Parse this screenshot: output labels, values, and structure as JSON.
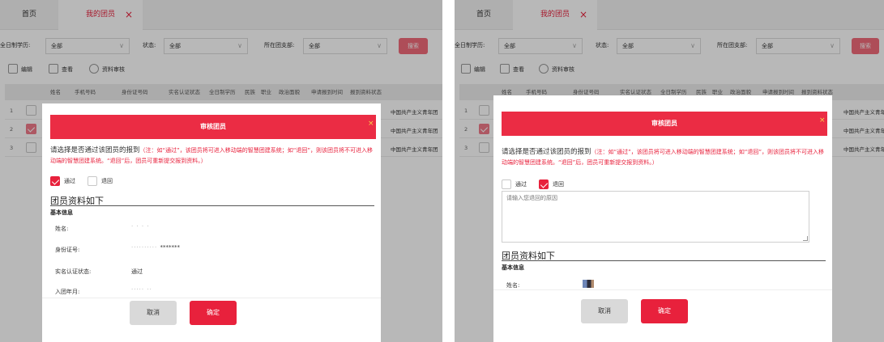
{
  "colors": {
    "accent": "#e8213c",
    "search": "#f16b7a",
    "dialog_header": "#eb2c44",
    "close_x": "#f7d34a"
  },
  "tabs": {
    "home": "首页",
    "current": "我的团员",
    "close": "×"
  },
  "filters": {
    "education_label": "全日制学历:",
    "education_value": "全部",
    "status_label": "状态:",
    "status_value": "全部",
    "branch_label": "所在团支部:",
    "branch_value": "全部",
    "search_label": "搜索"
  },
  "toolbar": {
    "edit": "编辑",
    "view": "查看",
    "review": "资料审核"
  },
  "table": {
    "headers": [
      "姓名",
      "手机号码",
      "身份证号码",
      "实名认证状态",
      "全日制学历",
      "民族",
      "职业",
      "政治面貌",
      "申请报到时间",
      "报到资料状态"
    ],
    "rows": [
      {
        "num": "1",
        "checked": false,
        "org": "中国共产主义青年团"
      },
      {
        "num": "2",
        "checked": true,
        "org": "中国共产主义青年团"
      },
      {
        "num": "3",
        "checked": false,
        "org": "中国共产主义青年团"
      }
    ]
  },
  "dialog": {
    "title": "审核团员",
    "close": "×",
    "question": "请选择是否通过该团员的报到",
    "note": "（注：如“通过”，该团员将可进入移动端的智慧团建系统；如“退回”，则该团员将不可进入移动端的智慧团建系统。“退回”后，团员可重新提交报到资料。）",
    "pass_label": "通过",
    "return_label": "退回",
    "reason_placeholder": "请输入您退回的原因",
    "info_title": "团员资料如下",
    "basic_info": "基本信息",
    "fields": {
      "name_label": "姓名:",
      "id_label": "身份证号:",
      "id_value": "*******",
      "realname_label": "实名认证状态:",
      "realname_value": "通过",
      "join_label": "入团年月:"
    },
    "cancel": "取消",
    "confirm": "确定"
  }
}
